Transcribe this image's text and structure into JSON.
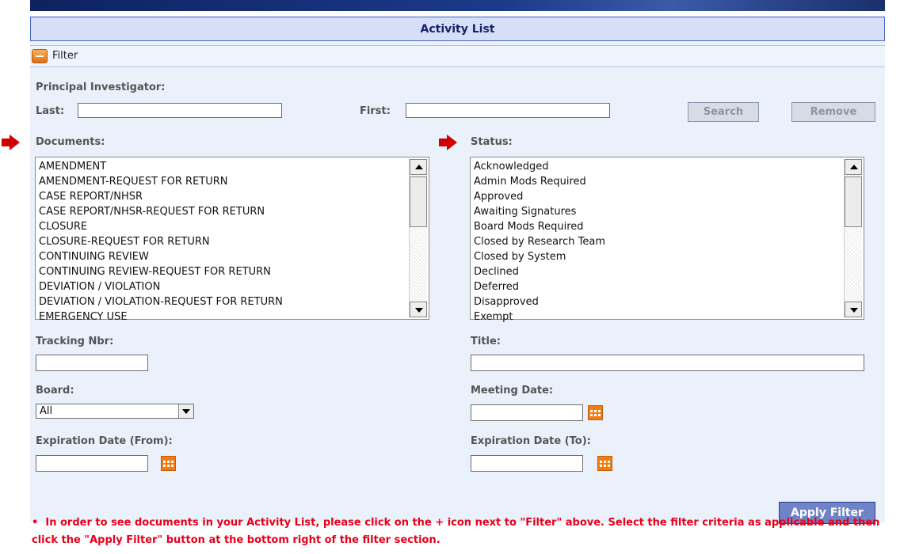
{
  "header": {
    "title": "Activity List"
  },
  "filter": {
    "label": "Filter"
  },
  "pi": {
    "heading": "Principal Investigator:",
    "last_label": "Last:",
    "first_label": "First:",
    "last_value": "",
    "first_value": ""
  },
  "buttons": {
    "search": "Search",
    "remove": "Remove",
    "apply": "Apply Filter"
  },
  "documents": {
    "label": "Documents:",
    "items": [
      "AMENDMENT",
      "AMENDMENT-REQUEST FOR RETURN",
      "CASE REPORT/NHSR",
      "CASE REPORT/NHSR-REQUEST FOR RETURN",
      "CLOSURE",
      "CLOSURE-REQUEST FOR RETURN",
      "CONTINUING REVIEW",
      "CONTINUING REVIEW-REQUEST FOR RETURN",
      "DEVIATION / VIOLATION",
      "DEVIATION / VIOLATION-REQUEST FOR RETURN",
      "EMERGENCY USE"
    ]
  },
  "status": {
    "label": "Status:",
    "items": [
      "Acknowledged",
      "Admin Mods Required",
      "Approved",
      "Awaiting Signatures",
      "Board Mods Required",
      "Closed by Research Team",
      "Closed by System",
      "Declined",
      "Deferred",
      "Disapproved",
      "Exempt"
    ]
  },
  "fields": {
    "tracking_label": "Tracking Nbr:",
    "title_label": "Title:",
    "board_label": "Board:",
    "board_value": "All",
    "meeting_label": "Meeting Date:",
    "exp_from_label": "Expiration Date (From):",
    "exp_to_label": "Expiration Date (To):"
  },
  "icons": {
    "toggle": "collapse-minus-icon",
    "arrow": "red-arrow-icon",
    "calendar": "calendar-icon"
  },
  "colors": {
    "title_bg": "#d6dff7",
    "note_text": "#e8001a",
    "apply_bg": "#6f84c8",
    "calendar": "#f27c14"
  },
  "note": {
    "bullet": "•",
    "text": "In order to see documents in your Activity List, please click on the + icon next to \"Filter\" above. Select the filter criteria as applicable and then click the \"Apply Filter\" button at the bottom right of the filter section."
  }
}
